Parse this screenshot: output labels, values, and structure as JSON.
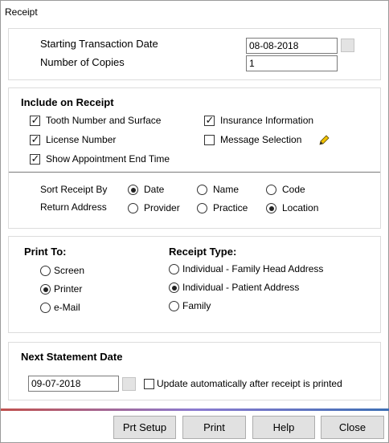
{
  "window": {
    "title": "Receipt"
  },
  "transaction": {
    "start_date_label": "Starting Transaction Date",
    "start_date_value": "08-08-2018",
    "copies_label": "Number of Copies",
    "copies_value": "1"
  },
  "include": {
    "heading": "Include on Receipt",
    "tooth_label": "Tooth Number and Surface",
    "tooth_checked": true,
    "license_label": "License Number",
    "license_checked": true,
    "appt_end_label": "Show Appointment End Time",
    "appt_end_checked": true,
    "insurance_label": "Insurance Information",
    "insurance_checked": true,
    "message_label": "Message Selection",
    "message_checked": false
  },
  "sort": {
    "label": "Sort Receipt By",
    "options": [
      "Date",
      "Name",
      "Code"
    ],
    "selected": "Date"
  },
  "return_address": {
    "label": "Return Address",
    "options": [
      "Provider",
      "Practice",
      "Location"
    ],
    "selected": "Location"
  },
  "print_to": {
    "heading": "Print To:",
    "options": [
      "Screen",
      "Printer",
      "e-Mail"
    ],
    "selected": "Printer"
  },
  "receipt_type": {
    "heading": "Receipt Type:",
    "options": [
      "Individual - Family Head Address",
      "Individual - Patient Address",
      "Family"
    ],
    "selected": "Individual - Patient Address"
  },
  "statement": {
    "heading": "Next Statement Date",
    "date_value": "09-07-2018",
    "auto_update_label": "Update automatically after receipt is printed",
    "auto_update_checked": false
  },
  "buttons": {
    "prt_setup": "Prt Setup",
    "print": "Print",
    "help": "Help",
    "close": "Close"
  }
}
